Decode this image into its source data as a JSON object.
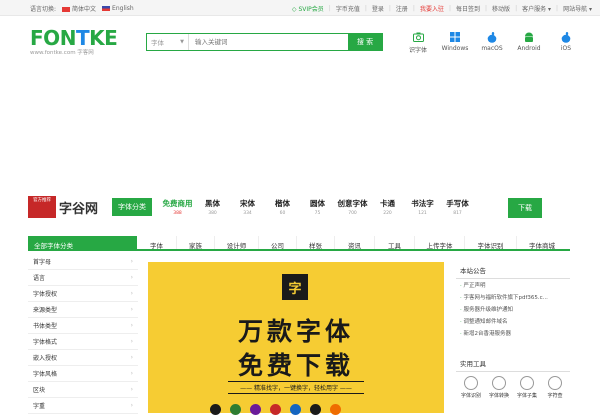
{
  "topbar": {
    "lang_label": "语言切换:",
    "lang_cn": "简体中文",
    "lang_en": "English",
    "links": [
      {
        "label": "SVIP会员"
      },
      {
        "label": "字币充值"
      },
      {
        "label": "登录"
      },
      {
        "label": "注册"
      },
      {
        "label": "我要入驻"
      },
      {
        "label": "每日签到"
      },
      {
        "label": "移动版"
      },
      {
        "label": "客户服务"
      },
      {
        "label": "网站导航"
      }
    ]
  },
  "logo": {
    "text": "FONTKE",
    "sub": "www.fontke.com 字客网"
  },
  "search": {
    "select_value": "字体",
    "placeholder": "输入关键词",
    "button": "搜 索"
  },
  "platforms": [
    {
      "label": "识字体",
      "icon": "camera-icon",
      "color": "#27a844"
    },
    {
      "label": "Windows",
      "icon": "windows-icon",
      "color": "#1e88e5"
    },
    {
      "label": "macOS",
      "icon": "apple-icon",
      "color": "#1e88e5"
    },
    {
      "label": "Android",
      "icon": "android-icon",
      "color": "#27a844"
    },
    {
      "label": "iOS",
      "icon": "apple-icon",
      "color": "#1e88e5"
    }
  ],
  "sponsor": {
    "badge": "官方推荐",
    "name": "字谷网",
    "category": "字体分类",
    "download": "下载",
    "items": [
      {
        "name": "免费商用",
        "count": "388"
      },
      {
        "name": "黑体",
        "count": "380"
      },
      {
        "name": "宋体",
        "count": "334"
      },
      {
        "name": "楷体",
        "count": "60"
      },
      {
        "name": "圆体",
        "count": "75"
      },
      {
        "name": "创意字体",
        "count": "700"
      },
      {
        "name": "卡通",
        "count": "220"
      },
      {
        "name": "书法字",
        "count": "121"
      },
      {
        "name": "手写体",
        "count": "817"
      }
    ]
  },
  "nav": {
    "all": "全部字体分类",
    "links": [
      "字体",
      "家族",
      "设计师",
      "公司",
      "样张",
      "资讯",
      "工具",
      "上传字体",
      "字体识别",
      "字体商城"
    ]
  },
  "sidebar": [
    "首字母",
    "语言",
    "字体授权",
    "来源类型",
    "书体类型",
    "字体格式",
    "嵌入授权",
    "字体风格",
    "区块",
    "字重"
  ],
  "banner": {
    "icon_char": "字",
    "line1": "万款字体",
    "line2": "免费下载",
    "tagline": "—— 精准找字，一键换字，轻松用字 ——",
    "dot_colors": [
      "#1a1a1a",
      "#2e7d32",
      "#6a1b9a",
      "#c62828",
      "#1565c0",
      "#1a1a1a",
      "#ef6c00"
    ]
  },
  "notice": {
    "title": "本站公告",
    "items": [
      "严正声明",
      "字客网与福昕软件旗下pdf365.c...",
      "服务器升级维护通知",
      "调整通知邮件域名",
      "新增2台香港服务器"
    ]
  },
  "tools": {
    "title": "实用工具",
    "items": [
      "字体识别",
      "字体转换",
      "字体子集",
      "字符查"
    ]
  }
}
